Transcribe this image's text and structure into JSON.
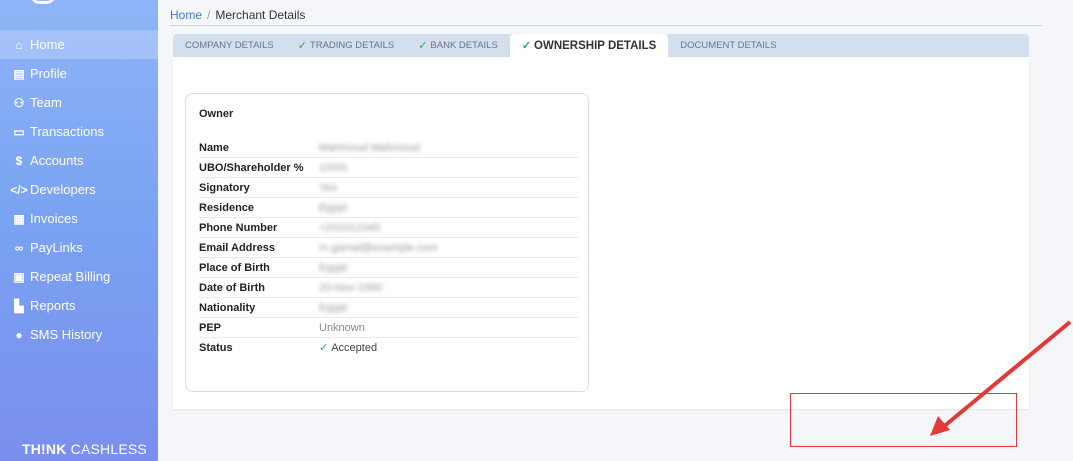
{
  "sidebar": {
    "items": [
      {
        "icon": "home-icon",
        "glyph": "⌂",
        "label": "Home",
        "active": true
      },
      {
        "icon": "id-card-icon",
        "glyph": "▤",
        "label": "Profile"
      },
      {
        "icon": "users-icon",
        "glyph": "⚇",
        "label": "Team"
      },
      {
        "icon": "card-icon",
        "glyph": "▭",
        "label": "Transactions"
      },
      {
        "icon": "dollar-icon",
        "glyph": "$",
        "label": "Accounts"
      },
      {
        "icon": "code-icon",
        "glyph": "</>",
        "label": "Developers"
      },
      {
        "icon": "invoice-icon",
        "glyph": "▦",
        "label": "Invoices"
      },
      {
        "icon": "link-icon",
        "glyph": "∞",
        "label": "PayLinks"
      },
      {
        "icon": "calendar-icon",
        "glyph": "▣",
        "label": "Repeat Billing"
      },
      {
        "icon": "chart-icon",
        "glyph": "▙",
        "label": "Reports"
      },
      {
        "icon": "chat-icon",
        "glyph": "●",
        "label": "SMS History"
      }
    ],
    "brand_bold": "TH!NK",
    "brand_rest": " CASHLESS"
  },
  "breadcrumb": {
    "home": "Home",
    "separator": "/",
    "current": "Merchant Details"
  },
  "tabs": [
    {
      "label": "COMPANY DETAILS",
      "checked": false,
      "active": false
    },
    {
      "label": "TRADING DETAILS",
      "checked": true,
      "active": false
    },
    {
      "label": "BANK DETAILS",
      "checked": true,
      "active": false
    },
    {
      "label": "OWNERSHIP DETAILS",
      "checked": true,
      "active": true
    },
    {
      "label": "DOCUMENT DETAILS",
      "checked": false,
      "active": false
    }
  ],
  "owner": {
    "title": "Owner",
    "rows": [
      {
        "label": "Name",
        "value": "Mahmoud Mahmoud",
        "blurred": true
      },
      {
        "label": "UBO/Shareholder %",
        "value": "100%",
        "blurred": true
      },
      {
        "label": "Signatory",
        "value": "Yes",
        "blurred": true
      },
      {
        "label": "Residence",
        "value": "Egypt",
        "blurred": true
      },
      {
        "label": "Phone Number",
        "value": "+201012345",
        "blurred": true
      },
      {
        "label": "Email Address",
        "value": "m.gamal@example.com",
        "blurred": true
      },
      {
        "label": "Place of Birth",
        "value": "Egypt",
        "blurred": true
      },
      {
        "label": "Date of Birth",
        "value": "20-Nov-1990",
        "blurred": true
      },
      {
        "label": "Nationality",
        "value": "Egypt",
        "blurred": true
      },
      {
        "label": "PEP",
        "value": "Unknown",
        "blurred": false
      },
      {
        "label": "Status",
        "value": "Accepted",
        "blurred": false,
        "status": true
      }
    ]
  },
  "colors": {
    "accent": "#3d7ad6",
    "check": "#2fa84f",
    "annotation": "#e53935"
  }
}
